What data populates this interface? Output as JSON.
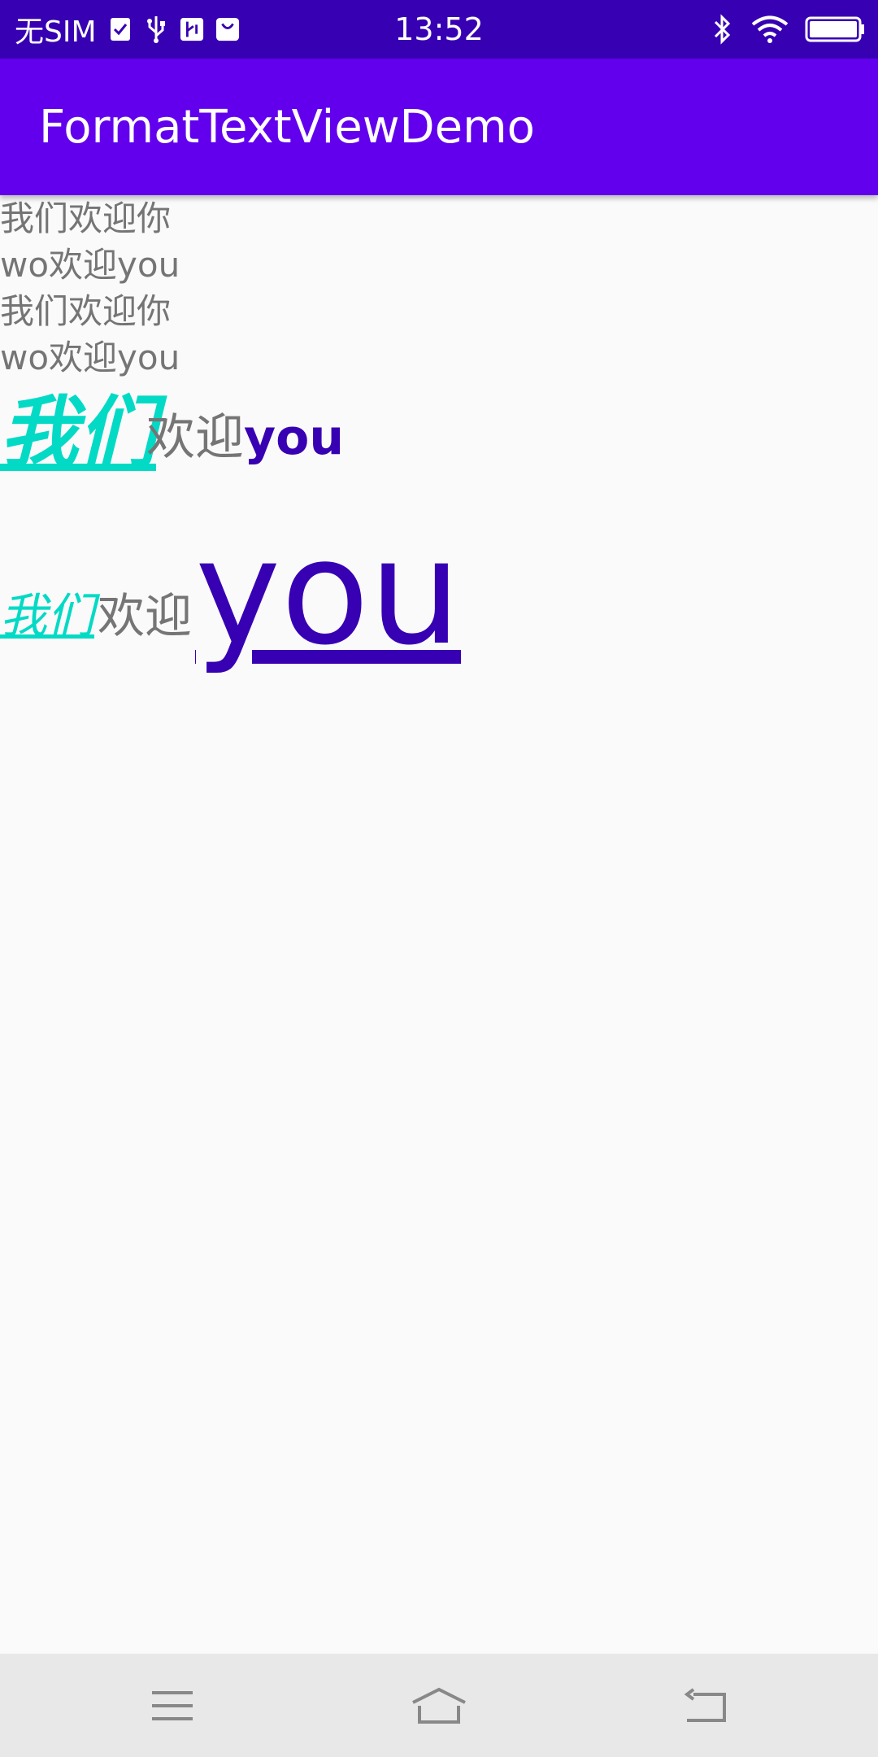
{
  "status_bar": {
    "carrier": "无SIM",
    "time": "13:52",
    "icons_left": [
      "sim-check-icon",
      "usb-icon",
      "usb-debug-icon",
      "bag-icon"
    ],
    "icons_right": [
      "bluetooth-icon",
      "wifi-icon",
      "battery-icon"
    ]
  },
  "app_bar": {
    "title": "FormatTextViewDemo",
    "color": "#6200ee",
    "status_color": "#3700b3"
  },
  "lines": [
    "我们欢迎你",
    "wo欢迎you",
    "我们欢迎你",
    "wo欢迎you"
  ],
  "rich_text_1": {
    "part1": "我们",
    "part2": "欢迎",
    "part3": "you",
    "colors": {
      "part1": "#03dac5",
      "part2": "#757575",
      "part3": "#3700b3"
    }
  },
  "rich_text_2": {
    "part1": "我们",
    "part2": "欢迎",
    "part3": "you",
    "colors": {
      "part1": "#03dac5",
      "part2": "#757575",
      "part3": "#3700b3"
    }
  },
  "nav_bar": {
    "buttons": [
      "menu-icon",
      "home-icon",
      "back-icon"
    ]
  }
}
